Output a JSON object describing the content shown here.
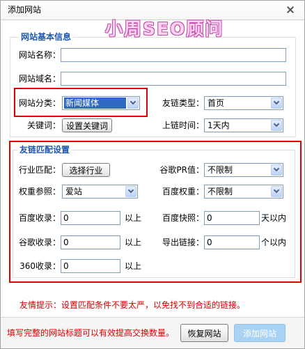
{
  "dialog": {
    "title": "添加网站",
    "watermark": "小周SEO顾问"
  },
  "basic": {
    "legend": "网站基本信息",
    "site_name": {
      "label": "网站名称：",
      "value": ""
    },
    "site_domain": {
      "label": "网站域名：",
      "value": ""
    },
    "category": {
      "label": "网站分类：",
      "selected": "新闻媒体"
    },
    "link_type": {
      "label": "友链类型：",
      "selected": "首页"
    },
    "keywords": {
      "label": "关键词：",
      "button_label": "设置关键词"
    },
    "link_time": {
      "label": "上链时间：",
      "selected": "1天内"
    }
  },
  "match": {
    "legend": "友链匹配设置",
    "industry": {
      "label": "行业匹配：",
      "button_label": "选择行业"
    },
    "google_pr": {
      "label": "谷歌PR值：",
      "selected": "不限制"
    },
    "weight_ref": {
      "label": "权重参照：",
      "selected": "爱站"
    },
    "baidu_weight": {
      "label": "百度权重：",
      "selected": "不限制"
    },
    "baidu_index": {
      "label": "百度收录：",
      "value": "0",
      "unit": "以上"
    },
    "baidu_snapshot": {
      "label": "百度快照：",
      "value": "0",
      "unit": "天以内"
    },
    "google_index": {
      "label": "谷歌收录：",
      "value": "0",
      "unit": "以上"
    },
    "outbound_links": {
      "label": "导出链接：",
      "value": "0",
      "unit": "个以内"
    },
    "index_360": {
      "label": "360收录：",
      "value": "0",
      "unit": "以上"
    }
  },
  "tip": "友情提示：设置匹配条件不要太严，以免找不到合适的链接。",
  "footer": {
    "hint": "填写完整的网站标题可以有效提高交换数量。",
    "restore_label": "恢复网站",
    "add_label": "添加网站"
  },
  "icons": {
    "close": "close-icon",
    "dropdown": "chevron-down-icon"
  },
  "colors": {
    "legend": "#1d57b0",
    "tip": "#d40000",
    "hint": "#e00000",
    "annotation": "#e10000",
    "selection": "#316ac5",
    "add_button": "#a9d3f4"
  }
}
